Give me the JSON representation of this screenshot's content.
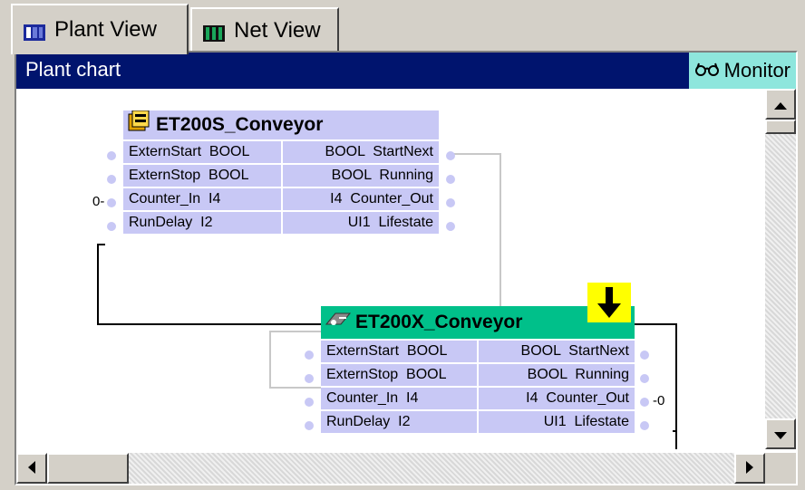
{
  "tabs": [
    {
      "label": "Plant View",
      "active": true,
      "icon": "plant-view-icon"
    },
    {
      "label": "Net View",
      "active": false,
      "icon": "net-view-icon"
    }
  ],
  "chart": {
    "title": "Plant chart",
    "monitor_label": "Monitor",
    "monitor_icon": "glasses-icon"
  },
  "blocks": [
    {
      "name": "ET200S_Conveyor",
      "icon": "module-icon",
      "inputs": [
        "ExternStart  BOOL",
        "ExternStop  BOOL",
        "Counter_In  I4",
        "RunDelay  I2"
      ],
      "outputs": [
        "BOOL  StartNext",
        "BOOL  Running",
        "I4  Counter_Out",
        "UI1  Lifestate"
      ]
    },
    {
      "name": "ET200X_Conveyor",
      "icon": "device-icon",
      "inputs": [
        "ExternStart  BOOL",
        "ExternStop  BOOL",
        "Counter_In  I4",
        "RunDelay  I2"
      ],
      "outputs": [
        "BOOL  StartNext",
        "BOOL  Running",
        "I4  Counter_Out",
        "UI1  Lifestate"
      ],
      "highlight_color": "#00c08a",
      "badge_icon": "down-arrow-icon"
    }
  ],
  "constants": {
    "block1_counter_in": "0-",
    "block2_counter_out": "-0"
  },
  "colors": {
    "titlebar": "#00146e",
    "monitor_bg": "#8ee6dd",
    "block_fill": "#c8c8f5",
    "arrow_badge": "#ffff00"
  }
}
